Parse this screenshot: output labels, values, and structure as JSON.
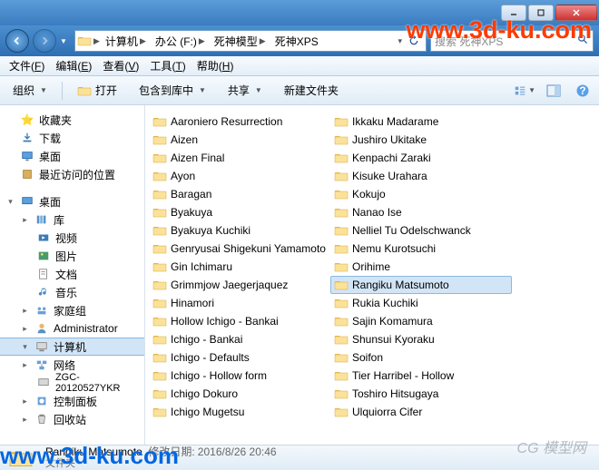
{
  "breadcrumb": [
    "计算机",
    "办公 (F:)",
    "死神模型",
    "死神XPS"
  ],
  "search_placeholder": "搜索 死神XPS",
  "menubar": [
    {
      "label": "文件",
      "key": "F"
    },
    {
      "label": "编辑",
      "key": "E"
    },
    {
      "label": "查看",
      "key": "V"
    },
    {
      "label": "工具",
      "key": "T"
    },
    {
      "label": "帮助",
      "key": "H"
    }
  ],
  "toolbar": {
    "organize": "组织",
    "open": "打开",
    "include": "包含到库中",
    "share": "共享",
    "newfolder": "新建文件夹"
  },
  "sidebar": {
    "favorites": {
      "label": "收藏夹",
      "items": [
        "下载",
        "桌面",
        "最近访问的位置"
      ]
    },
    "desktop": {
      "label": "桌面",
      "libraries": {
        "label": "库",
        "items": [
          "视频",
          "图片",
          "文档",
          "音乐"
        ]
      },
      "others": [
        "家庭组",
        "Administrator"
      ],
      "computer": {
        "label": "计算机",
        "items": [
          "网络",
          "ZGC-20120527YKR"
        ]
      },
      "more": [
        "控制面板",
        "回收站"
      ]
    }
  },
  "folders_col1": [
    "Aaroniero Resurrection",
    "Aizen",
    "Aizen Final",
    "Ayon",
    "Baragan",
    "Byakuya",
    "Byakuya Kuchiki",
    "Genryusai Shigekuni Yamamoto",
    "Gin Ichimaru",
    "Grimmjow Jaegerjaquez",
    "Hinamori",
    "Hollow Ichigo - Bankai",
    "Ichigo - Bankai",
    "Ichigo - Defaults",
    "Ichigo - Hollow form",
    "Ichigo Dokuro",
    "Ichigo Mugetsu",
    "Ikkaku Madarame",
    "Jushiro Ukitake",
    "Kenpachi Zaraki"
  ],
  "folders_col2": [
    "Kisuke Urahara",
    "Kokujo",
    "Nanao Ise",
    "Nelliel Tu Odelschwanck",
    "Nemu Kurotsuchi",
    "Orihime",
    "Rangiku Matsumoto",
    "Rukia Kuchiki",
    "Sajin Komamura",
    "Shunsui Kyoraku",
    "Soifon",
    "Tier Harribel - Hollow",
    "Toshiro Hitsugaya",
    "Ulquiorra Cifer"
  ],
  "selected_folder": "Rangiku Matsumoto",
  "status": {
    "name": "Rangiku Matsumoto",
    "meta_label": "修改日期:",
    "meta_value": "2016/8/26 20:46",
    "type": "文件夹"
  },
  "watermarks": {
    "w1": "www.3d-ku.com",
    "w2": "www.3d-ku.com",
    "w3": "CG 模型网"
  }
}
